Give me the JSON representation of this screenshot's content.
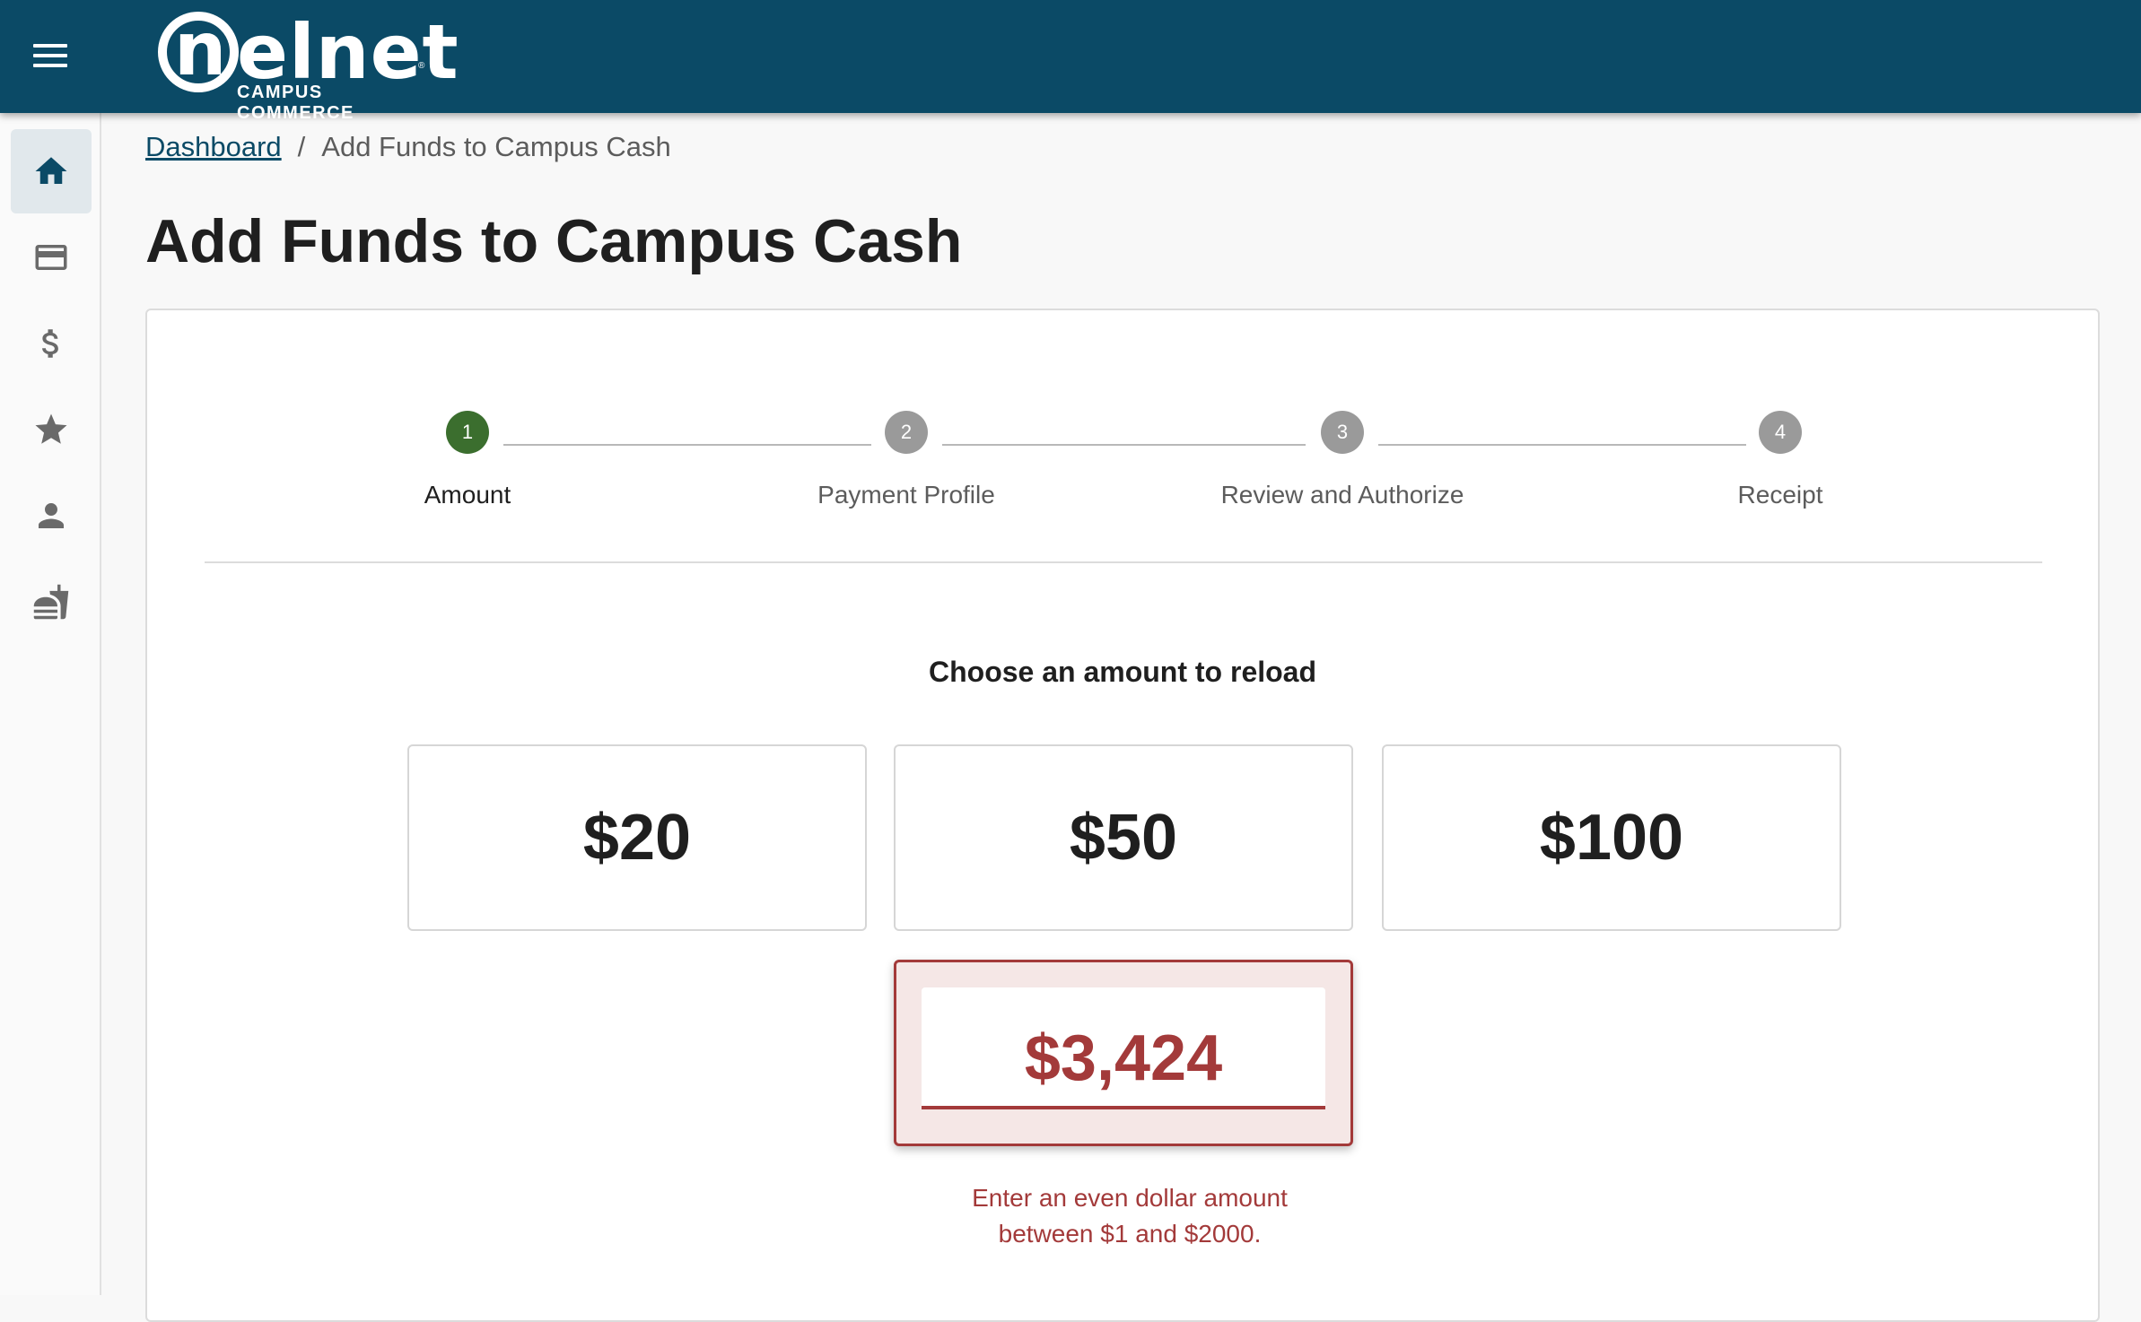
{
  "header": {
    "logo_word": "elnet",
    "logo_letter": "n",
    "logo_registered": "®",
    "logo_sub": "CAMPUS COMMERCE",
    "bg_color": "#0b4a66"
  },
  "sidebar": {
    "items": [
      {
        "icon": "home-icon",
        "active": true
      },
      {
        "icon": "credit-card-icon",
        "active": false
      },
      {
        "icon": "dollar-icon",
        "active": false
      },
      {
        "icon": "star-icon",
        "active": false
      },
      {
        "icon": "person-icon",
        "active": false
      },
      {
        "icon": "fastfood-icon",
        "active": false
      }
    ]
  },
  "breadcrumb": {
    "link": "Dashboard",
    "separator": "/",
    "current": "Add Funds to Campus Cash"
  },
  "page_title": "Add Funds to Campus Cash",
  "stepper": {
    "steps": [
      {
        "number": "1",
        "label": "Amount",
        "active": true
      },
      {
        "number": "2",
        "label": "Payment Profile",
        "active": false
      },
      {
        "number": "3",
        "label": "Review and Authorize",
        "active": false
      },
      {
        "number": "4",
        "label": "Receipt",
        "active": false
      }
    ],
    "active_color": "#3b6e2e"
  },
  "amount_section": {
    "heading": "Choose an amount to reload",
    "options": [
      "$20",
      "$50",
      "$100"
    ],
    "custom_value": "$3,424",
    "error_line1": "Enter an even dollar amount",
    "error_line2": "between $1 and $2000.",
    "error_color": "#a33a3a"
  }
}
